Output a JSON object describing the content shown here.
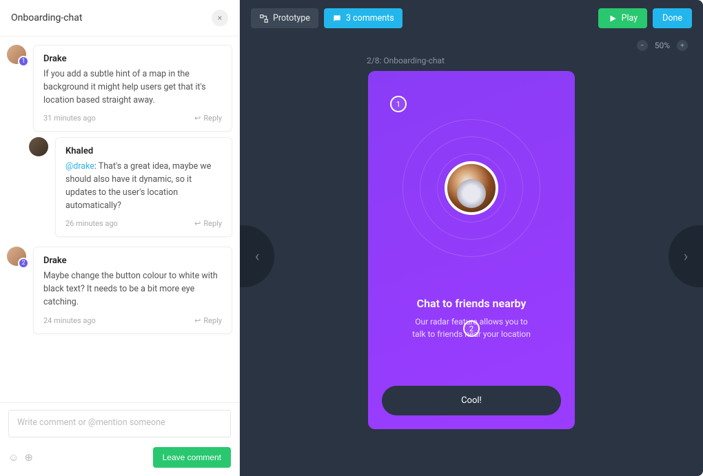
{
  "sidebar": {
    "title": "Onboarding-chat",
    "close_label": "×"
  },
  "threads": [
    {
      "pin": "1",
      "comments": [
        {
          "author": "Drake",
          "body": "If you add a subtle hint of a map in the background it might help users get that it's location based straight away.",
          "time": "31 minutes ago",
          "reply_label": "Reply"
        },
        {
          "author": "Khaled",
          "mention": "@drake",
          "body": ": That's a great idea, maybe we should also have it dynamic, so it updates to the user's location automatically?",
          "time": "26 minutes ago",
          "reply_label": "Reply",
          "is_reply": true
        }
      ]
    },
    {
      "pin": "2",
      "comments": [
        {
          "author": "Drake",
          "body": "Maybe change the button colour to white with black text? It needs to be a bit more eye catching.",
          "time": "24 minutes ago",
          "reply_label": "Reply"
        }
      ]
    }
  ],
  "composer": {
    "placeholder": "Write comment or @mention someone",
    "submit_label": "Leave comment"
  },
  "toolbar": {
    "prototype_label": "Prototype",
    "comments_label": "3 comments",
    "play_label": "Play",
    "done_label": "Done"
  },
  "zoom": {
    "value": "50%"
  },
  "screen": {
    "label": "2/8: Onboarding-chat",
    "pins": {
      "p1": "1",
      "p2": "2"
    },
    "title": "Chat to friends nearby",
    "subtitle_l1": "Our radar feature allows you to",
    "subtitle_l2": "talk to friends near your location",
    "button_label": "Cool!"
  }
}
